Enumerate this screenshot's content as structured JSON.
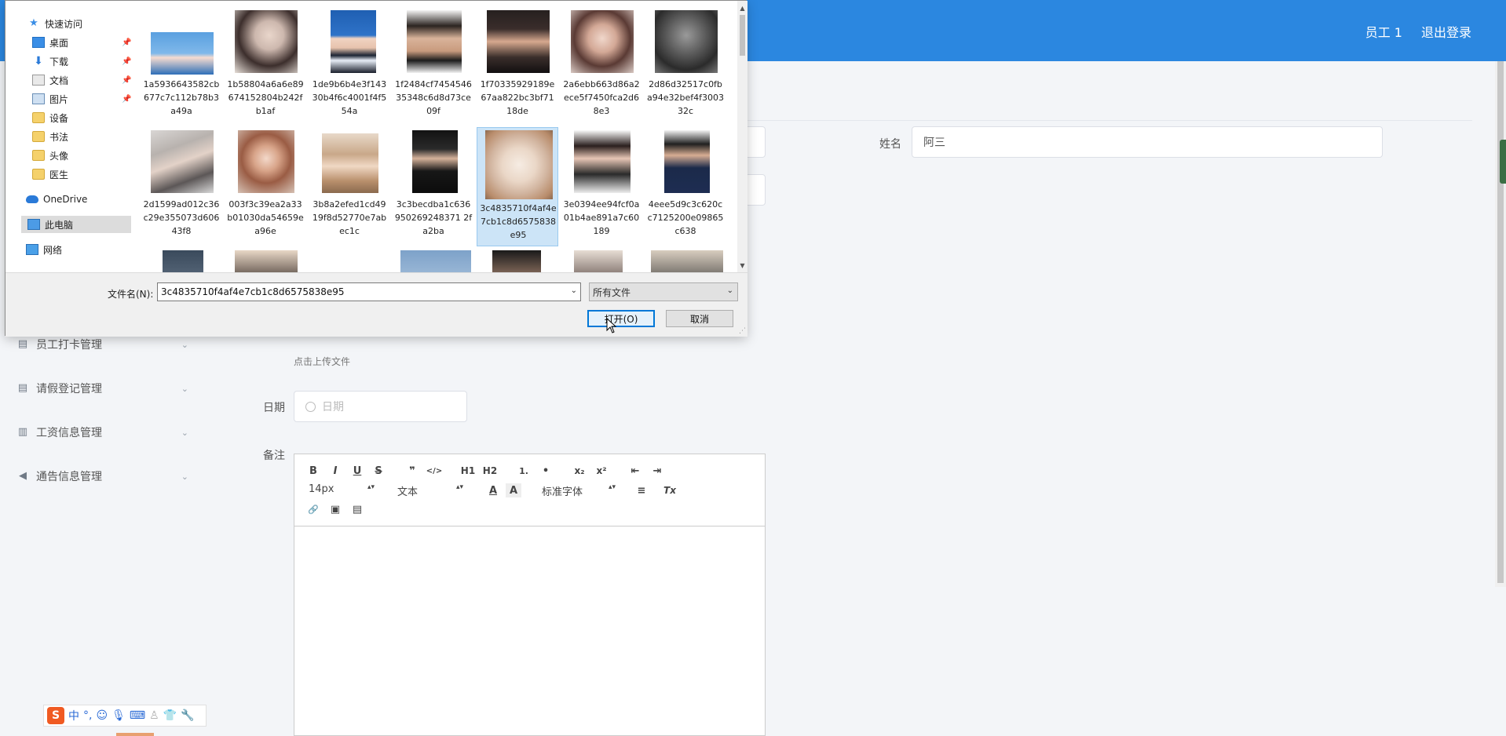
{
  "header": {
    "user": "员工 1",
    "logout": "退出登录"
  },
  "sidebar": {
    "items": [
      {
        "label": "员工打卡管理",
        "icon": "clipboard-icon"
      },
      {
        "label": "请假登记管理",
        "icon": "clipboard-icon"
      },
      {
        "label": "工资信息管理",
        "icon": "bar-chart-icon"
      },
      {
        "label": "通告信息管理",
        "icon": "megaphone-icon"
      }
    ]
  },
  "form": {
    "name_label": "姓名",
    "name_value": "阿三",
    "upload_hint": "点击上传文件",
    "date_label": "日期",
    "date_placeholder": "日期",
    "remark_label": "备注"
  },
  "editor": {
    "size_select": "14px",
    "header_select": "文本",
    "font_select": "标准字体",
    "buttons": [
      "B",
      "I",
      "U",
      "S",
      "❞",
      "</>",
      "H1",
      "H2",
      "1.",
      "•",
      "x₂",
      "x²",
      "⇤",
      "⇥",
      "A",
      "A",
      "≡",
      "Tx",
      "🔗",
      "▣",
      "▤"
    ]
  },
  "dialog": {
    "nav": [
      {
        "label": "快速访问",
        "icon": "star-icon",
        "pinned": false
      },
      {
        "label": "桌面",
        "icon": "desktop-icon",
        "pinned": true
      },
      {
        "label": "下载",
        "icon": "download-icon",
        "pinned": true
      },
      {
        "label": "文档",
        "icon": "document-icon",
        "pinned": true
      },
      {
        "label": "图片",
        "icon": "pictures-icon",
        "pinned": true
      },
      {
        "label": "设备",
        "icon": "folder-icon",
        "pinned": false
      },
      {
        "label": "书法",
        "icon": "folder-icon",
        "pinned": false
      },
      {
        "label": "头像",
        "icon": "folder-icon",
        "pinned": false
      },
      {
        "label": "医生",
        "icon": "folder-icon",
        "pinned": false
      },
      {
        "label": "OneDrive",
        "icon": "cloud-icon",
        "pinned": false
      },
      {
        "label": "此电脑",
        "icon": "computer-icon",
        "pinned": false,
        "selected": true
      },
      {
        "label": "网络",
        "icon": "network-icon",
        "pinned": false
      }
    ],
    "files": [
      {
        "name": "1a5936643582cb677c7c112b78b3a49a"
      },
      {
        "name": "1b58804a6a6e89674152804b242fb1af"
      },
      {
        "name": "1de9b6b4e3f14330b4f6c4001f4f554a"
      },
      {
        "name": "1f2484cf745454635348c6d8d73ce09f"
      },
      {
        "name": "1f70335929189e67aa822bc3bf7118de"
      },
      {
        "name": "2a6ebb663d86a2ece5f7450fca2d68e3"
      },
      {
        "name": "2d86d32517c0fba94e32bef4f300332c"
      },
      {
        "name": "2d1599ad012c36c29e355073d60643f8"
      },
      {
        "name": "003f3c39ea2a33b01030da54659ea96e"
      },
      {
        "name": "3b8a2efed1cd4919f8d52770e7abec1c"
      },
      {
        "name": "3c3becdba1c636950269248371 2fa2ba"
      },
      {
        "name": "3c4835710f4af4e7cb1c8d6575838e95",
        "selected": true
      },
      {
        "name": "3e0394ee94fcf0a01b4ae891a7c60189"
      },
      {
        "name": "4eee5d9c3c620cc7125200e09865c638"
      }
    ],
    "filename_label": "文件名(N):",
    "filename_value": "3c4835710f4af4e7cb1c8d6575838e95",
    "filter_value": "所有文件",
    "open_button": "打开(O)",
    "cancel_button": "取消"
  },
  "ime": {
    "logo": "S",
    "mode": "中",
    "punct": "°,"
  }
}
